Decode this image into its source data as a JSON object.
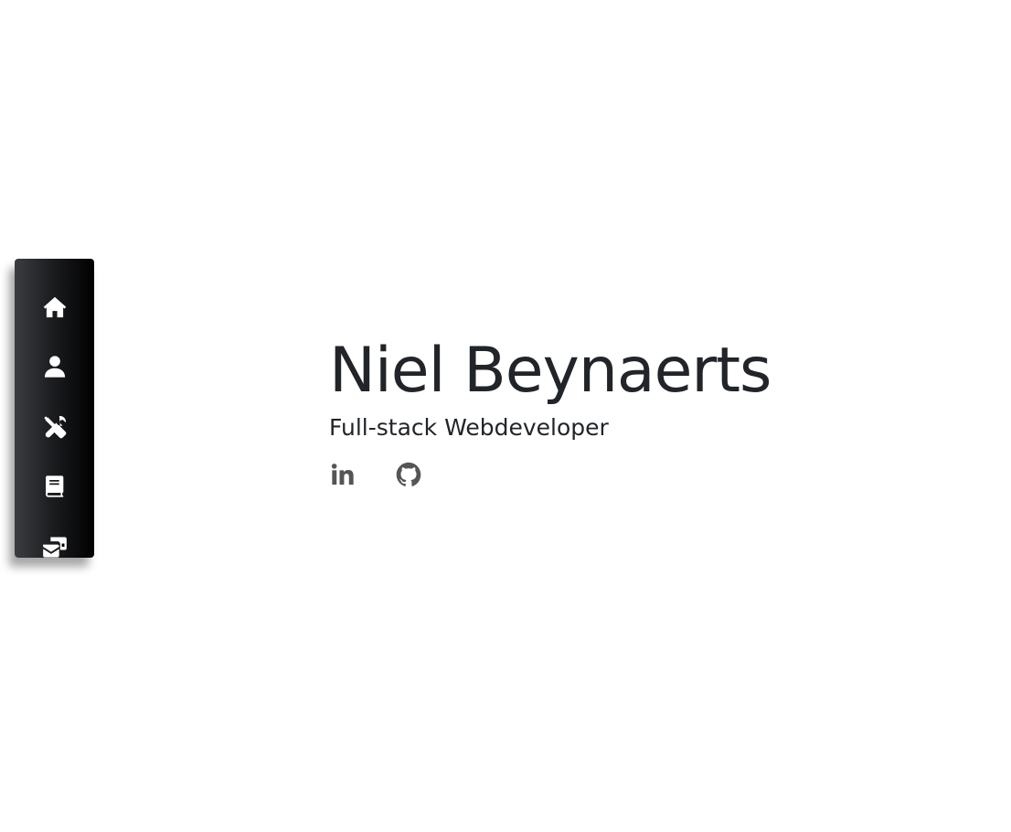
{
  "sidebar": {
    "items": [
      {
        "icon": "home-icon"
      },
      {
        "icon": "user-icon"
      },
      {
        "icon": "tools-icon"
      },
      {
        "icon": "book-icon"
      },
      {
        "icon": "contact-icon"
      }
    ]
  },
  "hero": {
    "name": "Niel Beynaerts",
    "subtitle": "Full-stack Webdeveloper"
  },
  "social": {
    "links": [
      {
        "icon": "linkedin-icon"
      },
      {
        "icon": "github-icon"
      }
    ]
  },
  "colors": {
    "text": "#212529",
    "nav_bg_dark": "#000000",
    "nav_bg_light": "#3b3d42",
    "icon": "#555555"
  }
}
